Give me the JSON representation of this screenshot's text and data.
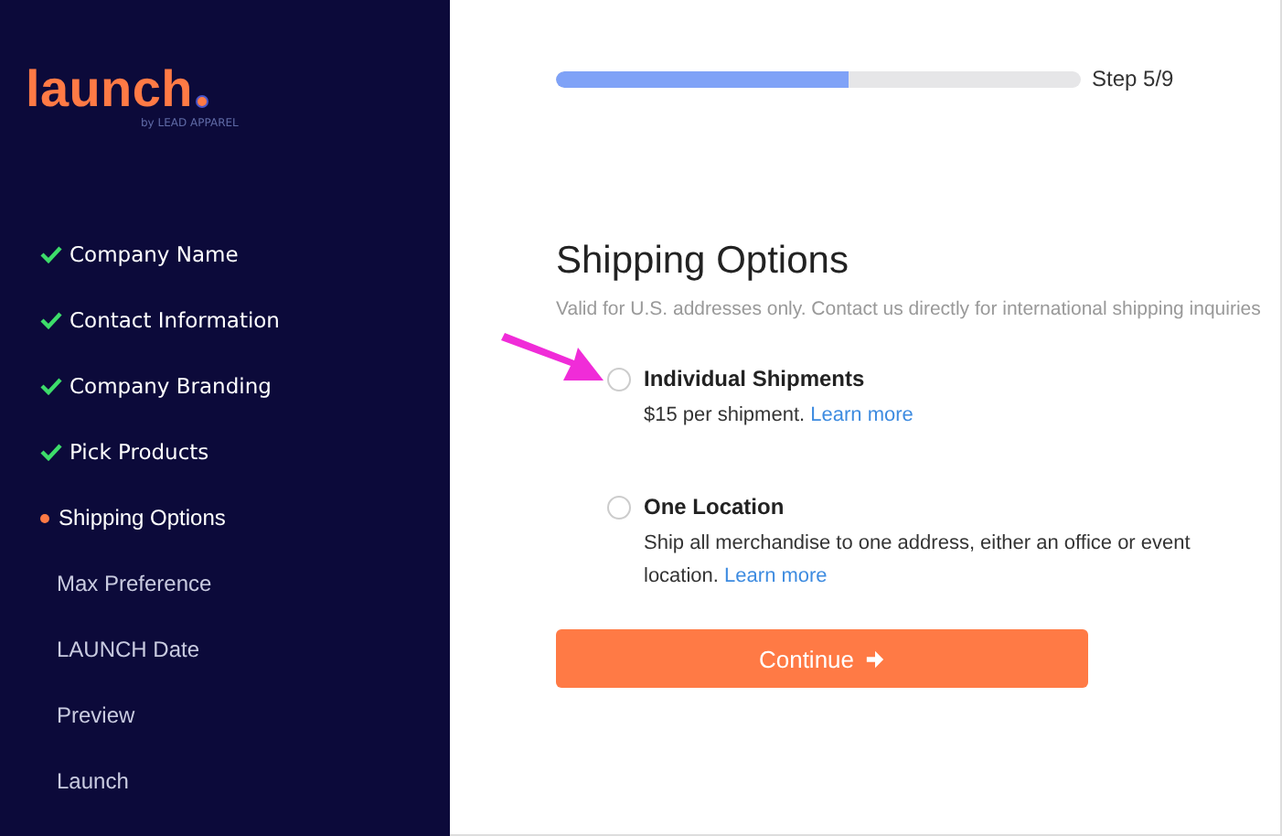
{
  "brand": {
    "logo": "launch",
    "tagline": "by LEAD APPAREL"
  },
  "steps": [
    {
      "label": "Company Name",
      "kind": "done"
    },
    {
      "label": "Contact Information",
      "kind": "done"
    },
    {
      "label": "Company Branding",
      "kind": "done"
    },
    {
      "label": "Pick Products",
      "kind": "done"
    },
    {
      "label": "Shipping Options",
      "kind": "current"
    },
    {
      "label": "Max Preference",
      "kind": "pending"
    },
    {
      "label": "LAUNCH Date",
      "kind": "pending"
    },
    {
      "label": "Preview",
      "kind": "pending"
    },
    {
      "label": "Launch",
      "kind": "pending"
    }
  ],
  "progress": {
    "level": 0.557,
    "label": "Step 5/9"
  },
  "title": "Shipping Options",
  "subtitle": "Valid for U.S. addresses only. Contact us directly for international shipping inquiries",
  "options": [
    {
      "title": "Individual Shipments",
      "description": "$15 per shipment.",
      "link": "Learn more",
      "selected": false
    },
    {
      "title": "One Location",
      "description": "Ship all merchandise to one address, either an office or event location.",
      "link": "Learn more",
      "selected": false
    }
  ],
  "continue_button": "Continue"
}
